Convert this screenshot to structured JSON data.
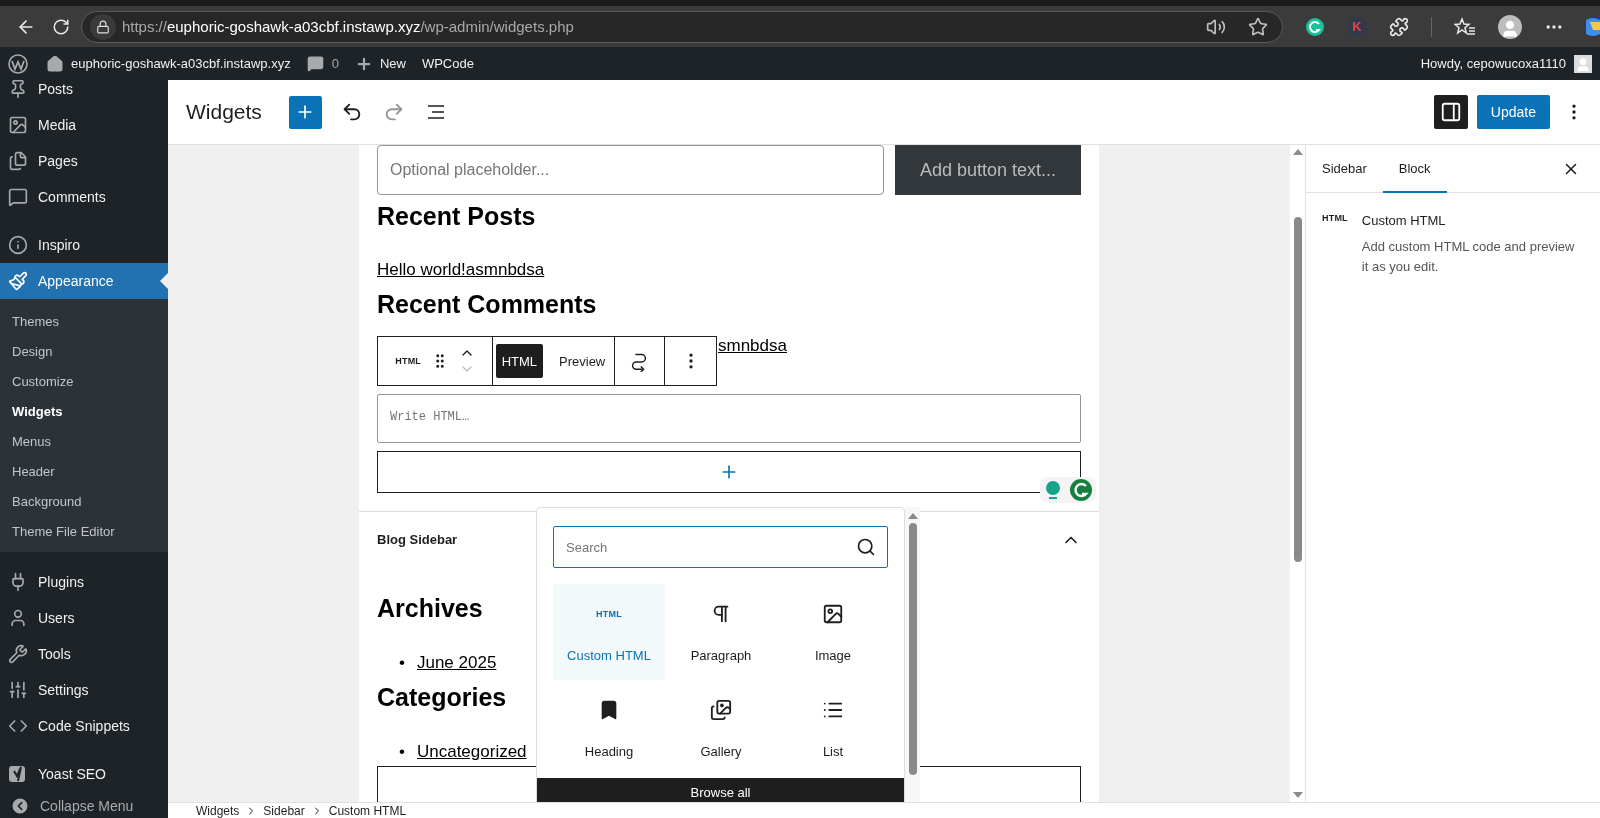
{
  "browser": {
    "url": {
      "scheme": "https://",
      "host": "euphoric-goshawk-a03cbf.instawp.xyz",
      "path": "/wp-admin/widgets.php"
    },
    "extension_letter": "K"
  },
  "admin_bar": {
    "site_name": "euphoric-goshawk-a03cbf.instawp.xyz",
    "comment_count": "0",
    "new_label": "New",
    "plugin_link": "WPCode",
    "greeting": "Howdy, cepowucoxa1110"
  },
  "sidebar": {
    "groups": [
      [
        {
          "label": "Posts",
          "selected": false
        },
        {
          "label": "Media",
          "selected": false
        },
        {
          "label": "Pages",
          "selected": false
        },
        {
          "label": "Comments",
          "selected": false
        }
      ],
      [
        {
          "label": "Inspiro",
          "selected": false
        },
        {
          "label": "Appearance",
          "selected": true,
          "children": [
            {
              "label": "Themes",
              "selected": false
            },
            {
              "label": "Design",
              "selected": false
            },
            {
              "label": "Customize",
              "selected": false
            },
            {
              "label": "Widgets",
              "selected": true
            },
            {
              "label": "Menus",
              "selected": false
            },
            {
              "label": "Header",
              "selected": false
            },
            {
              "label": "Background",
              "selected": false
            },
            {
              "label": "Theme File Editor",
              "selected": false
            }
          ]
        }
      ],
      [
        {
          "label": "Plugins",
          "selected": false
        },
        {
          "label": "Users",
          "selected": false
        },
        {
          "label": "Tools",
          "selected": false
        },
        {
          "label": "Settings",
          "selected": false
        },
        {
          "label": "Code Snippets",
          "selected": false
        }
      ],
      [
        {
          "label": "Yoast SEO",
          "selected": false
        }
      ]
    ],
    "collapse_label": "Collapse Menu"
  },
  "header": {
    "title": "Widgets",
    "redo_disabled": true,
    "settings_open": true,
    "update_label": "Update"
  },
  "canvas": {
    "search_block": {
      "placeholder": "Optional placeholder...",
      "button_label": "Add button text..."
    },
    "widgets": [
      {
        "kind": "heading",
        "text": "Recent Posts"
      },
      {
        "kind": "link",
        "text": "Hello world!asmnbdsa"
      },
      {
        "kind": "heading",
        "text": "Recent Comments"
      },
      {
        "kind": "comment",
        "text": "smnbdsa"
      }
    ],
    "block_toolbar": {
      "icon_text": "HTML",
      "modes": [
        {
          "label": "HTML",
          "selected": true
        },
        {
          "label": "Preview",
          "selected": false
        }
      ]
    },
    "html_block": {
      "placeholder": "Write HTML…"
    },
    "area": {
      "title": "Blog Sidebar",
      "expanded": true
    },
    "area_widgets": [
      {
        "kind": "heading",
        "text": "Archives"
      },
      {
        "kind": "list",
        "items": [
          {
            "marker": "•",
            "text": "June 2025"
          }
        ]
      },
      {
        "kind": "heading",
        "text": "Categories"
      },
      {
        "kind": "list",
        "items": [
          {
            "marker": "•",
            "text": "Uncategorized"
          }
        ]
      }
    ]
  },
  "inserter": {
    "search_placeholder": "Search",
    "items": [
      {
        "label": "Custom HTML",
        "selected": true,
        "icon_text": "HTML"
      },
      {
        "label": "Paragraph",
        "selected": false
      },
      {
        "label": "Image",
        "selected": false
      },
      {
        "label": "Heading",
        "selected": false
      },
      {
        "label": "Gallery",
        "selected": false
      },
      {
        "label": "List",
        "selected": false
      }
    ],
    "browse_all": "Browse all"
  },
  "settings_panel": {
    "tabs": [
      {
        "label": "Sidebar",
        "selected": false
      },
      {
        "label": "Block",
        "selected": true
      }
    ],
    "block": {
      "icon_text": "HTML",
      "title": "Custom HTML",
      "description": "Add custom HTML code and preview it as you edit."
    }
  },
  "breadcrumb": [
    "Widgets",
    "Sidebar",
    "Custom HTML"
  ]
}
